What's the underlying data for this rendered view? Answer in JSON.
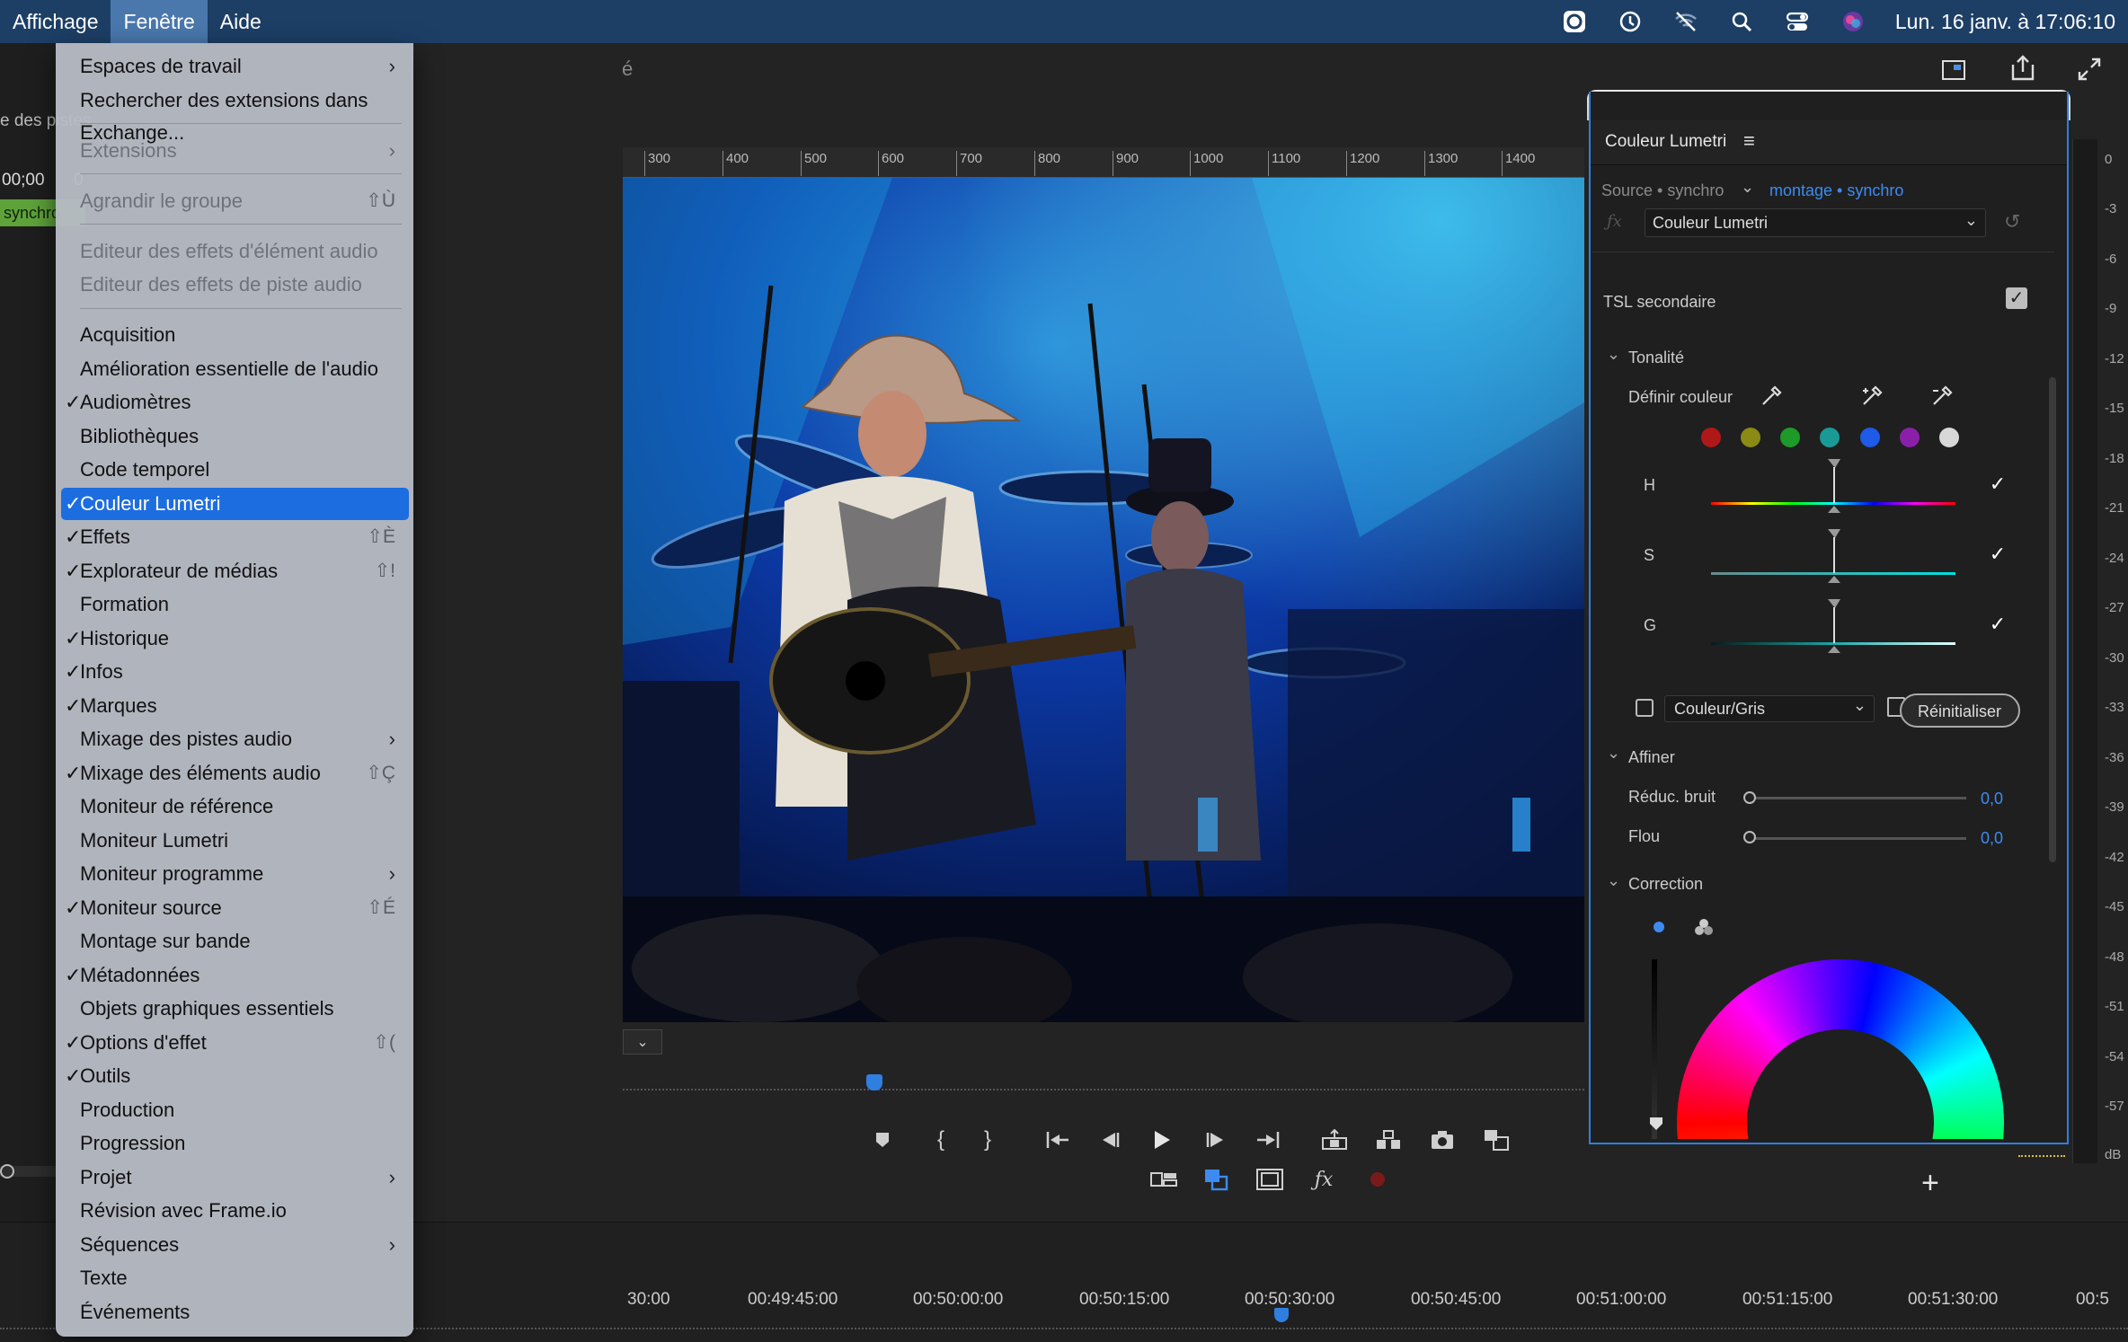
{
  "menubar": {
    "items": [
      "Affichage",
      "Fenêtre",
      "Aide"
    ],
    "active_index": 1,
    "clock": "Lun. 16 janv. à  17:06:10",
    "status_icons": [
      "screen-record-icon",
      "time-machine-icon",
      "wifi-off-icon",
      "search-icon",
      "control-center-icon",
      "siri-icon"
    ]
  },
  "menu": {
    "items": [
      {
        "label": "Espaces de travail",
        "submenu": true
      },
      {
        "label": "Rechercher des extensions dans Exchange..."
      },
      {
        "separator": true
      },
      {
        "label": "Extensions",
        "submenu": true,
        "disabled": true
      },
      {
        "separator": true
      },
      {
        "label": "Agrandir le groupe",
        "shortcut": "⇧Ù",
        "disabled": true
      },
      {
        "separator": true
      },
      {
        "label": "Editeur des effets d'élément audio",
        "disabled": true
      },
      {
        "label": "Editeur des effets de piste audio",
        "disabled": true
      },
      {
        "separator": true
      },
      {
        "label": "Acquisition"
      },
      {
        "label": "Amélioration essentielle de l'audio"
      },
      {
        "label": "Audiomètres",
        "checked": true
      },
      {
        "label": "Bibliothèques"
      },
      {
        "label": "Code temporel"
      },
      {
        "label": "Couleur Lumetri",
        "checked": true,
        "highlighted": true
      },
      {
        "label": "Effets",
        "checked": true,
        "shortcut": "⇧È"
      },
      {
        "label": "Explorateur de médias",
        "checked": true,
        "shortcut": "⇧!"
      },
      {
        "label": "Formation"
      },
      {
        "label": "Historique",
        "checked": true
      },
      {
        "label": "Infos",
        "checked": true
      },
      {
        "label": "Marques",
        "checked": true
      },
      {
        "label": "Mixage des pistes audio",
        "submenu": true
      },
      {
        "label": "Mixage des éléments audio",
        "checked": true,
        "shortcut": "⇧Ç"
      },
      {
        "label": "Moniteur de référence"
      },
      {
        "label": "Moniteur Lumetri"
      },
      {
        "label": "Moniteur programme",
        "submenu": true
      },
      {
        "label": "Moniteur source",
        "checked": true,
        "shortcut": "⇧É"
      },
      {
        "label": "Montage sur bande"
      },
      {
        "label": "Métadonnées",
        "checked": true
      },
      {
        "label": "Objets graphiques essentiels"
      },
      {
        "label": "Options d'effet",
        "checked": true,
        "shortcut": "⇧("
      },
      {
        "label": "Outils",
        "checked": true
      },
      {
        "label": "Production"
      },
      {
        "label": "Progression"
      },
      {
        "label": "Projet",
        "submenu": true
      },
      {
        "label": "Révision avec Frame.io"
      },
      {
        "label": "Séquences",
        "submenu": true
      },
      {
        "label": "Texte"
      },
      {
        "label": "Événements"
      }
    ]
  },
  "left_panel": {
    "label": "e des pistes",
    "timecode": "00;00",
    "extra": "0",
    "clip_name": "synchro"
  },
  "program_monitor": {
    "title_fragment": "é",
    "ruler_ticks": [
      "300",
      "400",
      "500",
      "600",
      "700",
      "800",
      "900",
      "1000",
      "1100",
      "1200",
      "1300",
      "1400"
    ]
  },
  "timeline": {
    "timecodes": [
      "30:00",
      "00:49:45:00",
      "00:50:00:00",
      "00:50:15:00",
      "00:50:30:00",
      "00:50:45:00",
      "00:51:00:00",
      "00:51:15:00",
      "00:51:30:00",
      "00:5"
    ]
  },
  "meter": {
    "labels": [
      "0",
      "-3",
      "-6",
      "-9",
      "-12",
      "-15",
      "-18",
      "-21",
      "-24",
      "-27",
      "-30",
      "-33",
      "-36",
      "-39",
      "-42",
      "-45",
      "-48",
      "-51",
      "-54",
      "-57",
      "dB"
    ]
  },
  "lumetri": {
    "panel_title": "Couleur Lumetri",
    "source_label": "Source • synchro",
    "sequence_label": "montage • synchro",
    "effect_select": "Couleur Lumetri",
    "section_tsl": "TSL secondaire",
    "section_tonalite": "Tonalité",
    "define_color": "Définir couleur",
    "swatches": [
      "#b01818",
      "#8a8a14",
      "#1e9a2a",
      "#1a9a96",
      "#1f5ae8",
      "#8a20a8",
      "#d8d8d8"
    ],
    "channels": [
      {
        "label": "H",
        "checked": true
      },
      {
        "label": "S",
        "checked": true
      },
      {
        "label": "G",
        "checked": true
      }
    ],
    "color_gray_select": "Couleur/Gris",
    "color_gray_checked": false,
    "reset_button": "Réinitialiser",
    "section_affiner": "Affiner",
    "denoise_label": "Réduc. bruit",
    "denoise_value": "0,0",
    "blur_label": "Flou",
    "blur_value": "0,0",
    "section_correction": "Correction",
    "tsl_checked": true
  },
  "transport": {
    "buttons": [
      "add-marker-icon",
      "mark-in-icon",
      "mark-out-icon",
      "go-to-in-icon",
      "step-back-icon",
      "play-icon",
      "step-forward-icon",
      "go-to-out-icon",
      "lift-icon",
      "extract-icon",
      "export-frame-icon",
      "compare-view-icon"
    ],
    "secondary": [
      "multicam-icon",
      "proxy-toggle-icon",
      "safe-margins-icon",
      "fx-toggle-icon",
      "record-icon"
    ],
    "add_button": "+"
  }
}
